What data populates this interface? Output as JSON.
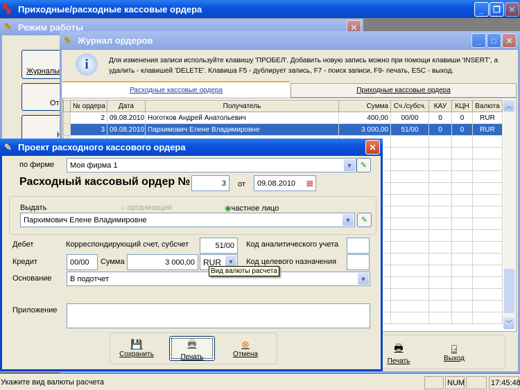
{
  "app": {
    "title": "Приходные/расходные кассовые ордера"
  },
  "mode_window": {
    "title": "Режим работы",
    "buttons": [
      "Журналы",
      "Отч",
      "Н"
    ]
  },
  "journal": {
    "title": "Журнал ордеров",
    "info": "Для изменения записи используйте клавишу 'ПРОБЕЛ'. Добавить новую запись можно при помощи клавиши 'INSERT', а удалить - клавишей 'DELETE'. Клавиша F5 - дублирует запись, F7 - поиск записи, F9- печать, ESC - выход.",
    "tabs": [
      {
        "label": "Расходные кассовые ордера",
        "active": true
      },
      {
        "label": "Приходные кассовые ордера",
        "active": false
      }
    ],
    "columns": [
      "№ ордера",
      "Дата",
      "Получатель",
      "Сумма",
      "Сч./субсч.",
      "КАУ",
      "КЦН",
      "Валюта"
    ],
    "rows": [
      [
        "2",
        "09.08.2010",
        "Ноготков Андрей Анатольевич",
        "400,00",
        "00/00",
        "0",
        "0",
        "RUR"
      ],
      [
        "3",
        "09.08.2010",
        "Пархимович Елене Владимировне",
        "3 000,00",
        "51/00",
        "0",
        "0",
        "RUR"
      ]
    ],
    "selected_row": 1,
    "buttons": {
      "print": "Печать",
      "exit": "Выход"
    }
  },
  "dialog": {
    "title": "Проект расходного кассового ордера",
    "firm_label": "по фирме",
    "firm": "Моя фирма 1",
    "heading": "Расходный кассовый ордер №",
    "number": "3",
    "from_label": "от",
    "date": "09.08.2010",
    "issue_label": "Выдать",
    "radio_org": "организация",
    "radio_person": "частное лицо",
    "recipient": "Пархимович Елене Владимировне",
    "debit_label": "Дебет",
    "corr_label": "Корреспондирующий счет, субсчет",
    "corr_value": "51/00",
    "analytic_label": "Код аналитического учета",
    "analytic_value": "",
    "credit_label": "Кредит",
    "credit_value": "00/00",
    "sum_label": "Сумма",
    "sum_value": "3 000,00",
    "currency": "RUR",
    "purpose_label": "Код целевого назначения",
    "purpose_value": "",
    "tooltip": "Вид валюты расчета",
    "basis_label": "Основание",
    "basis": "В подотчет",
    "attach_label": "Приложение",
    "attach": "",
    "buttons": {
      "save": "Сохранить",
      "print": "Печать",
      "cancel": "Отмена"
    }
  },
  "status": {
    "message": "Укажите вид валюты расчета",
    "num": "NUM",
    "time": "17:45:48"
  }
}
